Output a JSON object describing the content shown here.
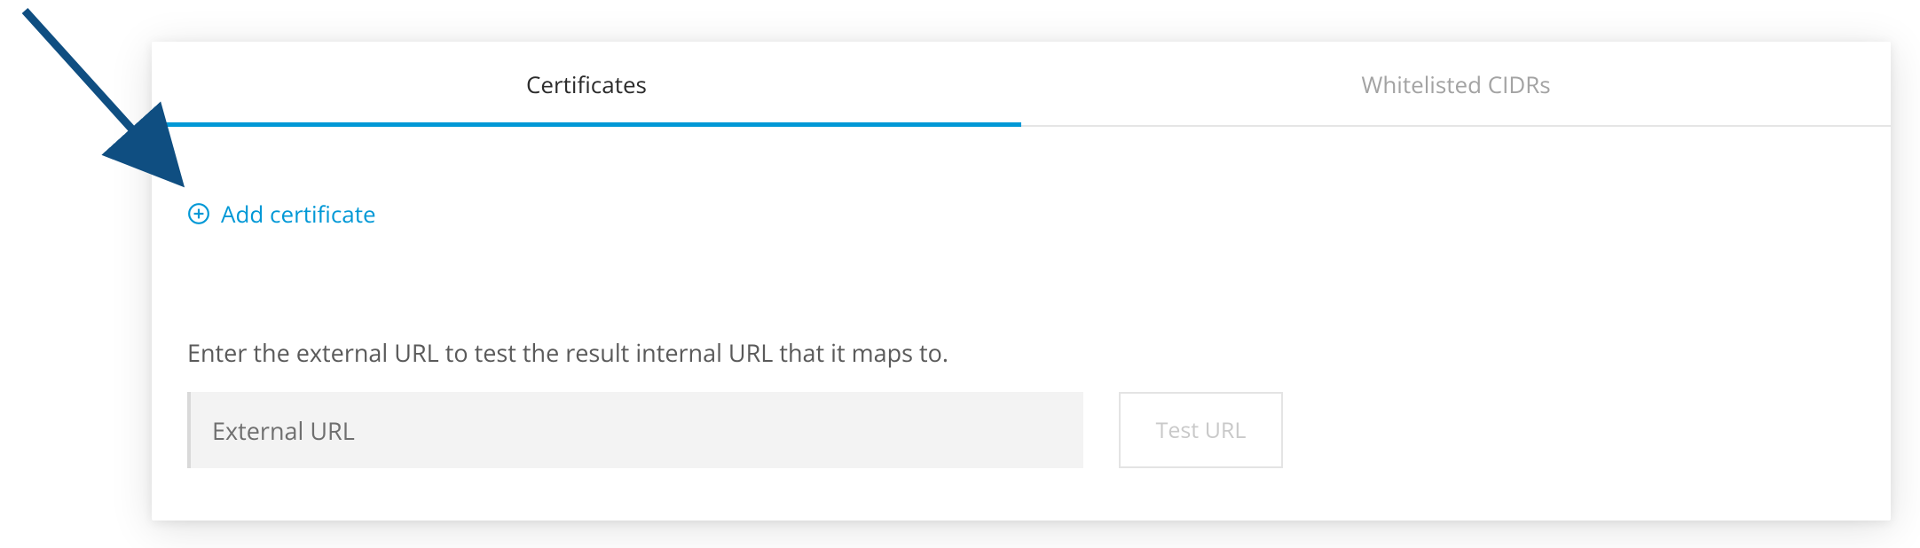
{
  "tabs": {
    "certificates": "Certificates",
    "whitelisted": "Whitelisted CIDRs"
  },
  "actions": {
    "add_certificate": "Add certificate"
  },
  "urlTest": {
    "instruction": "Enter the external URL to test the result internal URL that it maps to.",
    "placeholder": "External URL",
    "button": "Test URL"
  },
  "colors": {
    "accent": "#0098d6",
    "arrow": "#0f4e81"
  }
}
